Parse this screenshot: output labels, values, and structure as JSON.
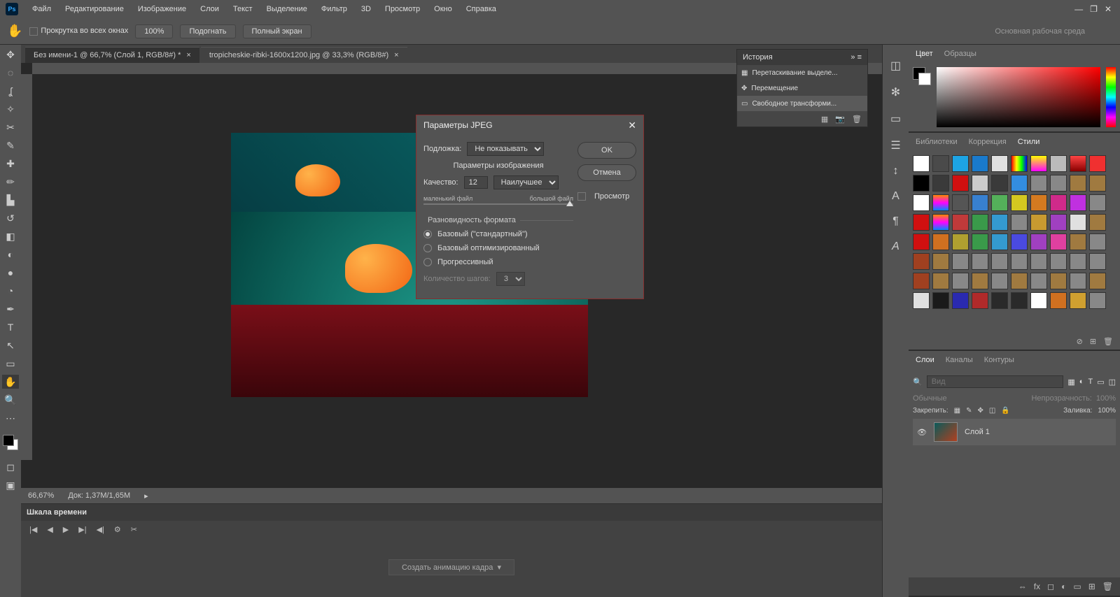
{
  "app": {
    "logo": "Ps"
  },
  "menu": {
    "file": "Файл",
    "edit": "Редактирование",
    "image": "Изображение",
    "layer": "Слои",
    "text": "Текст",
    "select": "Выделение",
    "filter": "Фильтр",
    "three_d": "3D",
    "view": "Просмотр",
    "window": "Окно",
    "help": "Справка"
  },
  "options": {
    "scroll_all": "Прокрутка во всех окнах",
    "zoom": "100%",
    "fit": "Подогнать",
    "fullscreen": "Полный экран",
    "workspace": "Основная рабочая среда"
  },
  "tabs": {
    "active": "Без имени-1 @ 66,7% (Слой 1, RGB/8#) *",
    "inactive": "tropicheskie-ribki-1600x1200.jpg @ 33,3% (RGB/8#)"
  },
  "status": {
    "zoom": "66,67%",
    "doc": "Док: 1,37M/1,65M"
  },
  "history": {
    "title": "История",
    "items": [
      "Перетаскивание выделе...",
      "Перемещение",
      "Свободное трансформи..."
    ]
  },
  "panels": {
    "color": {
      "color": "Цвет",
      "swatches": "Образцы"
    },
    "libs": {
      "libraries": "Библиотеки",
      "correction": "Коррекция",
      "styles": "Стили"
    },
    "layers": {
      "layers": "Слои",
      "channels": "Каналы",
      "paths": "Контуры",
      "search_placeholder": "Вид",
      "mode": "Обычные",
      "opacity_label": "Непрозрачность:",
      "opacity": "100%",
      "lock_label": "Закрепить:",
      "fill_label": "Заливка:",
      "fill": "100%",
      "layer1": "Слой 1"
    }
  },
  "timeline": {
    "title": "Шкала времени",
    "create": "Создать анимацию кадра"
  },
  "dialog": {
    "title": "Параметры JPEG",
    "matte_label": "Подложка:",
    "matte_value": "Не показывать",
    "image_opts": "Параметры изображения",
    "quality_label": "Качество:",
    "quality_value": "12",
    "quality_preset": "Наилучшее",
    "small_file": "маленький файл",
    "big_file": "большой файл",
    "format_opts": "Разновидность формата",
    "baseline": "Базовый (\"стандартный\")",
    "baseline_opt": "Базовый оптимизированный",
    "progressive": "Прогрессивный",
    "scans_label": "Количество шагов:",
    "scans_value": "3",
    "ok": "OK",
    "cancel": "Отмена",
    "preview": "Просмотр"
  },
  "style_colors": [
    "#ffffff",
    "#4a4a4a",
    "#1da4e4",
    "#1a7acc",
    "#e0e0e0",
    "linear-gradient(90deg,#f00,#ff0,#0f0,#00f)",
    "linear-gradient(#ff0,#f0f)",
    "#bbbbbb",
    "linear-gradient(#f44,#800)",
    "#f03030",
    "#000000",
    "#3a3a3a",
    "#d01010",
    "#cccccc",
    "#3a3a3a",
    "#338de0",
    "#888888",
    "#888888",
    "#a07a40",
    "#a07a40",
    "#ffffff",
    "linear-gradient(#f80,#f0f,#08f)",
    "#555555",
    "#3880d0",
    "#54b05a",
    "#d4c820",
    "#d47a20",
    "#d02a8a",
    "#c030e0",
    "#888888",
    "#d01010",
    "linear-gradient(#f80,#f0f,#08f)",
    "#c03a3a",
    "#3a9a4a",
    "#349ad0",
    "#888888",
    "#c89a30",
    "#a040c0",
    "#e0e0e0",
    "#a07a40",
    "#d01010",
    "#d07020",
    "#b0a030",
    "#3a9a4a",
    "#349ad0",
    "#4a4ae0",
    "#a040c0",
    "#e040a0",
    "#a07a40",
    "#888888",
    "#a04020",
    "#a07a40",
    "#888888",
    "#888888",
    "#888888",
    "#888888",
    "#888888",
    "#888888",
    "#888888",
    "#888888",
    "#a04020",
    "#a07a40",
    "#888888",
    "#a07a40",
    "#888888",
    "#a07a40",
    "#888888",
    "#a07a40",
    "#888888",
    "#a07a40",
    "#e0e0e0",
    "#1a1a1a",
    "#2a2ab0",
    "#b02a2a",
    "#2a2a2a",
    "#2a2a2a",
    "#ffffff",
    "#d07020",
    "#d0a030",
    "#888888"
  ]
}
